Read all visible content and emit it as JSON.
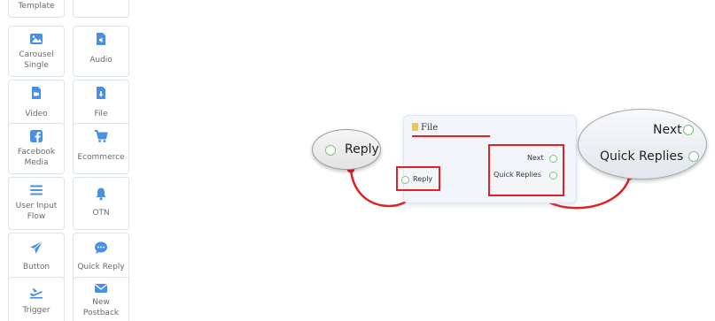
{
  "palette": {
    "tiles": [
      {
        "label": "Template",
        "icon": "template-icon"
      },
      {
        "label": "",
        "icon": "blank-tile"
      },
      {
        "label": "Carousel Single",
        "icon": "image-icon"
      },
      {
        "label": "Audio",
        "icon": "audio-file-icon"
      },
      {
        "label": "Video",
        "icon": "video-file-icon"
      },
      {
        "label": "File",
        "icon": "download-file-icon"
      },
      {
        "label": "Facebook Media",
        "icon": "facebook-icon"
      },
      {
        "label": "Ecommerce",
        "icon": "cart-icon"
      },
      {
        "label": "User Input Flow",
        "icon": "lines-icon"
      },
      {
        "label": "OTN",
        "icon": "bell-icon"
      },
      {
        "label": "Button",
        "icon": "send-icon"
      },
      {
        "label": "Quick Reply",
        "icon": "chat-bubble-icon"
      },
      {
        "label": "Trigger",
        "icon": "plane-icon"
      },
      {
        "label": "New Postback",
        "icon": "envelope-icon"
      }
    ]
  },
  "flow": {
    "reply_node": {
      "label": "Reply"
    },
    "file_node": {
      "title": "File",
      "input_label": "Reply",
      "outputs": [
        "Next",
        "Quick Replies"
      ]
    },
    "target_node": {
      "labels": [
        "Next",
        "Quick Replies"
      ]
    }
  },
  "colors": {
    "accent_icon": "#4a90e2",
    "annotation_red": "#e32026",
    "port_green": "#7cc47a"
  }
}
